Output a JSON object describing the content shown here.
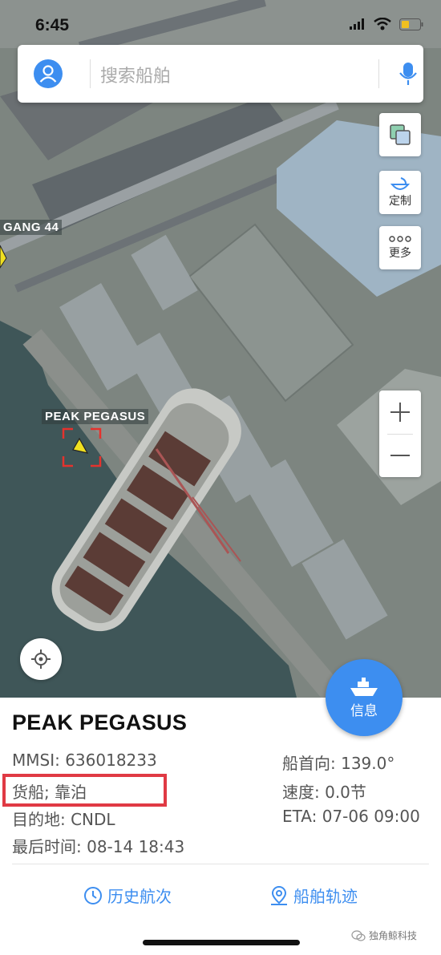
{
  "status": {
    "time": "6:45"
  },
  "search": {
    "placeholder": "搜索船舶"
  },
  "tools": [
    {
      "id": "layers",
      "label": ""
    },
    {
      "id": "custom",
      "label": "定制"
    },
    {
      "id": "more",
      "label": "更多"
    }
  ],
  "map_labels": {
    "ship_partial": "GANG 44",
    "ship_selected": "PEAK PEGASUS"
  },
  "info_button": {
    "label": "信息"
  },
  "ship": {
    "name": "PEAK PEGASUS",
    "mmsi": "MMSI: 636018233",
    "type_status": "货船; 靠泊",
    "destination": "目的地: CNDL",
    "last_time": "最后时间: 08-14 18:43",
    "heading": "船首向: 139.0°",
    "speed": "速度: 0.0节",
    "eta": "ETA: 07-06 09:00"
  },
  "actions": {
    "history": "历史航次",
    "track": "船舶轨迹"
  },
  "watermark": {
    "text": "独角鲸科技"
  },
  "colors": {
    "accent": "#3d8ef0",
    "highlight": "#e03a44",
    "ship_marker": "#f0e020"
  }
}
